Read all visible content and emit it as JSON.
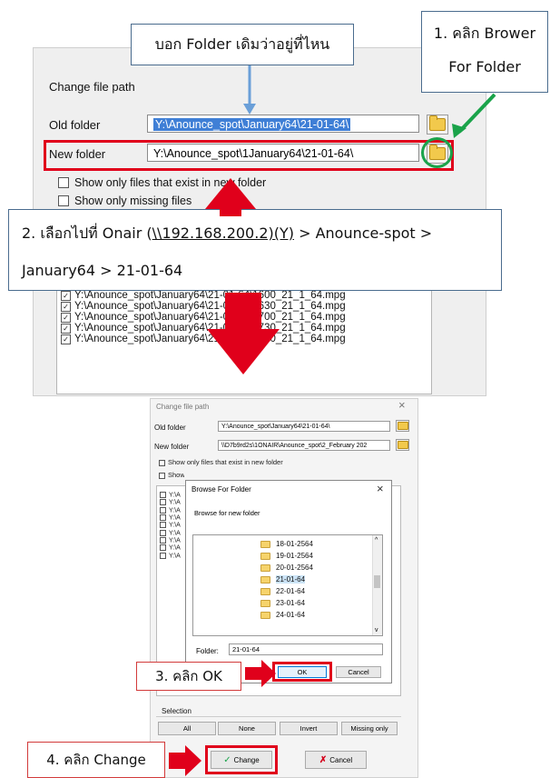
{
  "top_dialog": {
    "title": "Change file path",
    "old_folder_label": "Old folder",
    "old_folder_value": "Y:\\Anounce_spot\\January64\\21-01-64\\",
    "new_folder_label": "New folder",
    "new_folder_value": "Y:\\Anounce_spot\\1January64\\21-01-64\\",
    "checkbox_existing": "Show only files that exist in new folder",
    "checkbox_missing": "Show only missing files",
    "files": [
      "Y:\\Anounce_spot\\January64\\21-01-64\\1600_21_1_64.mpg",
      "Y:\\Anounce_spot\\January64\\21-01-64\\1630_21_1_64.mpg",
      "Y:\\Anounce_spot\\January64\\21-01-64\\1700_21_1_64.mpg",
      "Y:\\Anounce_spot\\January64\\21-01-64\\1730_21_1_64.mpg",
      "Y:\\Anounce_spot\\January64\\21-01-64\\1800_21_1_64.mpg"
    ]
  },
  "callouts": {
    "where_old": "บอก Folder เดิมว่าอยู่ที่ไหน",
    "step1_line1": "1. คลิก Brower",
    "step1_line2": "For Folder",
    "step2_prefix": "2. เลือกไปที่  Onair (",
    "step2_link": "\\\\192.168.200.2)(Y)",
    "step2_suffix": " > Anounce-spot >",
    "step2_line2": "January64 > 21-01-64",
    "step3": "3. คลิก OK",
    "step4": "4. คลิก Change"
  },
  "bottom_dialog": {
    "title": "Change file path",
    "close": "×",
    "old_folder_label": "Old folder",
    "old_folder_value": "Y:\\Anounce_spot\\January64\\21-01-64\\",
    "new_folder_label": "New folder",
    "new_folder_value": "\\\\D7b9rd2s\\1ONAIR\\Anounce_spot\\2_February 202",
    "checkbox_existing": "Show only files that exist in new folder",
    "checkbox_missing": "Show only missing files",
    "list_prefix": "Y:\\A",
    "selection_label": "Selection",
    "selection_buttons": [
      "All",
      "None",
      "Invert",
      "Missing only"
    ],
    "change_button": "Change",
    "cancel_button": "Cancel"
  },
  "browse_dialog": {
    "title": "Browse For Folder",
    "close": "×",
    "subtitle": "Browse for new folder",
    "folders": [
      "18-01-2564",
      "19-01-2564",
      "20-01-2564",
      "21-01-64",
      "22-01-64",
      "23-01-64",
      "24-01-64"
    ],
    "selected_folder": "21-01-64",
    "folder_label": "Folder:",
    "folder_value": "21-01-64",
    "ok_button": "OK",
    "cancel_button": "Cancel"
  },
  "colors": {
    "annotation_red": "#e0001b",
    "annotation_green": "#1aa34a",
    "callout_border": "#4a6c8e",
    "arrow_blue": "#6a9fd8",
    "selection_blue": "#3f7fd6"
  }
}
